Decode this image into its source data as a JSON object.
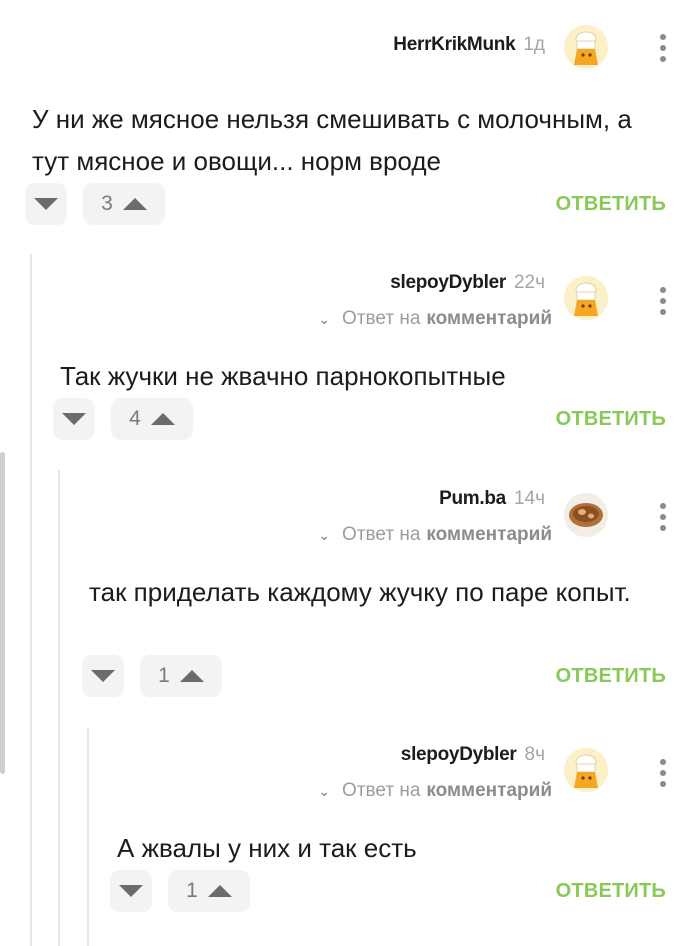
{
  "reply_button_label": "ОТВЕТИТЬ",
  "reply_to_prefix": "Ответ на",
  "reply_to_link": "комментарий",
  "accent_color": "#8ac858",
  "comments": [
    {
      "author": "HerrKrikMunk",
      "time": "1д",
      "text": "У ни же мясное нельзя смешивать с молочным, а тут мясное и овощи... норм вроде",
      "rating": "3",
      "avatar_icon": "chef-hat-avatar"
    },
    {
      "author": "slepoyDybler",
      "time": "22ч",
      "text": "Так жучки не жвачно парнокопытные",
      "rating": "4",
      "avatar_icon": "chef-hat-avatar"
    },
    {
      "author": "Pum.ba",
      "time": "14ч",
      "text": "так приделать каждому жучку по паре копыт.",
      "rating": "1",
      "avatar_icon": "cookie-avatar"
    },
    {
      "author": "slepoyDybler",
      "time": "8ч",
      "text": "А жвалы у них и так есть",
      "rating": "1",
      "avatar_icon": "chef-hat-avatar"
    }
  ]
}
